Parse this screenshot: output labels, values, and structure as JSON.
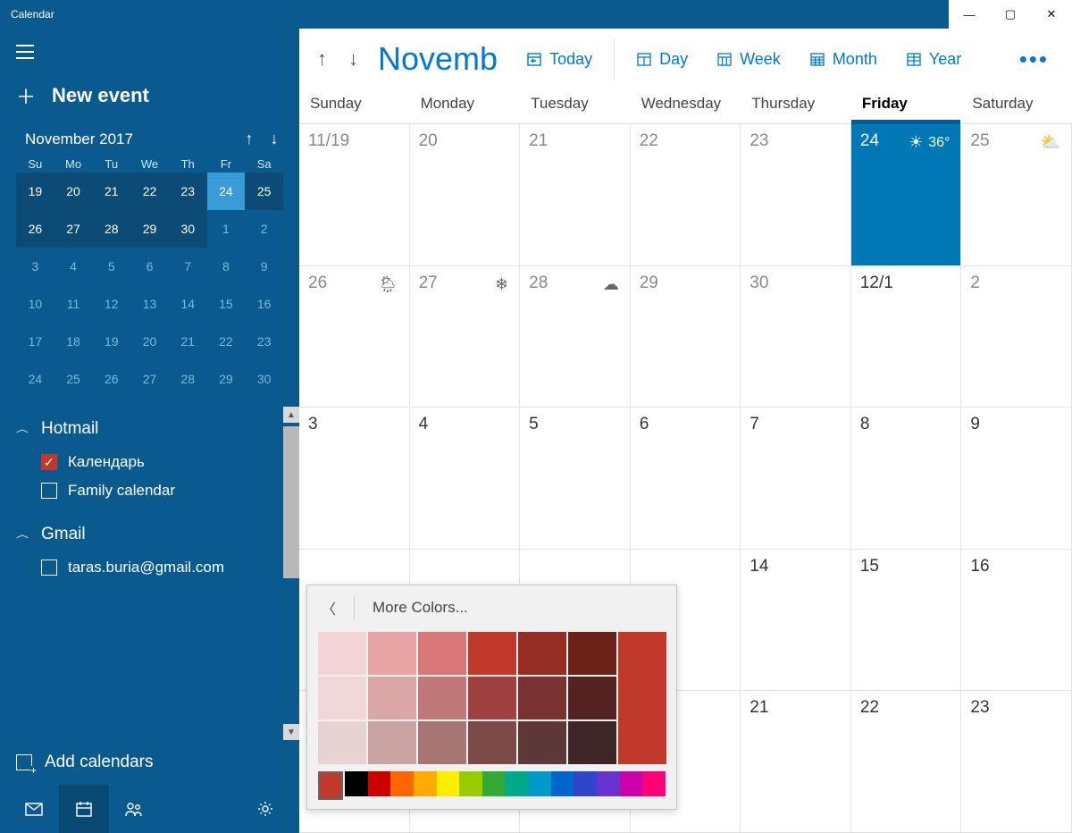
{
  "window": {
    "title": "Calendar"
  },
  "sidebar": {
    "newEvent": "New event",
    "miniTitle": "November 2017",
    "dow": [
      "Su",
      "Mo",
      "Tu",
      "We",
      "Th",
      "Fr",
      "Sa"
    ],
    "grid": [
      [
        {
          "n": "19",
          "c": true
        },
        {
          "n": "20",
          "c": true
        },
        {
          "n": "21",
          "c": true
        },
        {
          "n": "22",
          "c": true
        },
        {
          "n": "23",
          "c": true
        },
        {
          "n": "24",
          "c": true,
          "sel": true
        },
        {
          "n": "25",
          "c": true,
          "we": true
        }
      ],
      [
        {
          "n": "26",
          "c": true
        },
        {
          "n": "27",
          "c": true
        },
        {
          "n": "28",
          "c": true
        },
        {
          "n": "29",
          "c": true
        },
        {
          "n": "30",
          "c": true
        },
        {
          "n": "1"
        },
        {
          "n": "2"
        }
      ],
      [
        {
          "n": "3"
        },
        {
          "n": "4"
        },
        {
          "n": "5"
        },
        {
          "n": "6"
        },
        {
          "n": "7"
        },
        {
          "n": "8"
        },
        {
          "n": "9"
        }
      ],
      [
        {
          "n": "10"
        },
        {
          "n": "11"
        },
        {
          "n": "12"
        },
        {
          "n": "13"
        },
        {
          "n": "14"
        },
        {
          "n": "15"
        },
        {
          "n": "16"
        }
      ],
      [
        {
          "n": "17"
        },
        {
          "n": "18"
        },
        {
          "n": "19"
        },
        {
          "n": "20"
        },
        {
          "n": "21"
        },
        {
          "n": "22"
        },
        {
          "n": "23"
        }
      ],
      [
        {
          "n": "24"
        },
        {
          "n": "25"
        },
        {
          "n": "26"
        },
        {
          "n": "27"
        },
        {
          "n": "28"
        },
        {
          "n": "29"
        },
        {
          "n": "30"
        }
      ]
    ],
    "accounts": [
      {
        "name": "Hotmail",
        "items": [
          {
            "label": "Календарь",
            "checked": true
          },
          {
            "label": "Family calendar",
            "checked": false
          }
        ]
      },
      {
        "name": "Gmail",
        "items": [
          {
            "label": "taras.buria@gmail.com",
            "checked": false
          }
        ]
      }
    ],
    "addCalendars": "Add calendars"
  },
  "toolbar": {
    "month": "Novemb",
    "today": "Today",
    "views": [
      "Day",
      "Week",
      "Month",
      "Year"
    ]
  },
  "dow": [
    "Sunday",
    "Monday",
    "Tuesday",
    "Wednesday",
    "Thursday",
    "Friday",
    "Saturday"
  ],
  "todayIndex": 5,
  "weeks": [
    [
      {
        "n": "11/19"
      },
      {
        "n": "20"
      },
      {
        "n": "21"
      },
      {
        "n": "22"
      },
      {
        "n": "23"
      },
      {
        "n": "24",
        "today": true,
        "wx": "☀",
        "temp": "36°"
      },
      {
        "n": "25",
        "wx": "⛅"
      }
    ],
    [
      {
        "n": "26",
        "wx": "🌦"
      },
      {
        "n": "27",
        "wx": "❄"
      },
      {
        "n": "28",
        "wx": "☁"
      },
      {
        "n": "29"
      },
      {
        "n": "30"
      },
      {
        "n": "12/1",
        "in": true
      },
      {
        "n": "2"
      }
    ],
    [
      {
        "n": "3",
        "in": true
      },
      {
        "n": "4",
        "in": true
      },
      {
        "n": "5",
        "in": true
      },
      {
        "n": "6",
        "in": true
      },
      {
        "n": "7",
        "in": true
      },
      {
        "n": "8",
        "in": true
      },
      {
        "n": "9",
        "in": true
      }
    ],
    [
      {
        "n": ""
      },
      {
        "n": ""
      },
      {
        "n": ""
      },
      {
        "n": ""
      },
      {
        "n": "14",
        "in": true
      },
      {
        "n": "15",
        "in": true
      },
      {
        "n": "16",
        "in": true
      }
    ],
    [
      {
        "n": ""
      },
      {
        "n": ""
      },
      {
        "n": ""
      },
      {
        "n": ""
      },
      {
        "n": "21",
        "in": true
      },
      {
        "n": "22",
        "in": true
      },
      {
        "n": "23",
        "in": true
      }
    ]
  ],
  "popup": {
    "title": "More Colors...",
    "shades": [
      [
        "#f4d4d4",
        "#e7a5a5",
        "#d97777",
        "#c0392b",
        "#962d22",
        "#6b2018"
      ],
      [
        "#f0d8d8",
        "#dba6a6",
        "#c17878",
        "#a04040",
        "#7a3131",
        "#552222"
      ],
      [
        "#e8d3d3",
        "#caa3a3",
        "#a87575",
        "#7d4a4a",
        "#5d3838",
        "#3f2626"
      ]
    ],
    "accent": "#c0392b",
    "hues": [
      "#c0392b",
      "#000000",
      "#cc0000",
      "#ff6600",
      "#ffaa00",
      "#ffee00",
      "#99cc00",
      "#33aa33",
      "#00aa88",
      "#0099cc",
      "#0066cc",
      "#3344cc",
      "#6633cc",
      "#cc00aa",
      "#ff0077"
    ]
  }
}
